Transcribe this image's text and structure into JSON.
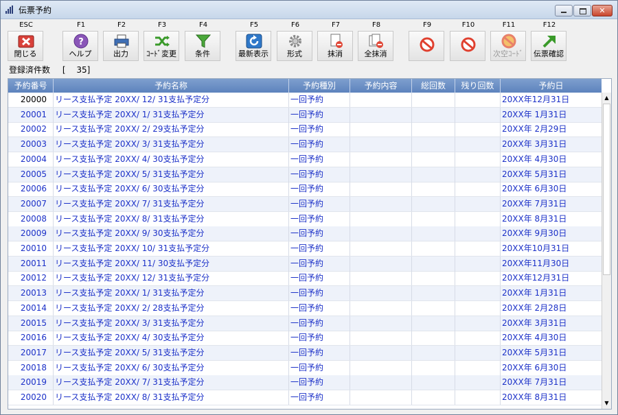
{
  "window": {
    "title": "伝票予約"
  },
  "toolbar": {
    "buttons": [
      {
        "key": "ESC",
        "label": "閉じる",
        "icon": "close-icon"
      },
      {
        "key": "F1",
        "label": "ヘルプ",
        "icon": "help-icon"
      },
      {
        "key": "F2",
        "label": "出力",
        "icon": "printer-icon"
      },
      {
        "key": "F3",
        "label": "ｺｰﾄﾞ変更",
        "icon": "shuffle-icon"
      },
      {
        "key": "F4",
        "label": "条件",
        "icon": "filter-icon"
      },
      {
        "key": "F5",
        "label": "最新表示",
        "icon": "refresh-icon"
      },
      {
        "key": "F6",
        "label": "形式",
        "icon": "gear-icon"
      },
      {
        "key": "F7",
        "label": "抹消",
        "icon": "delete-document-icon"
      },
      {
        "key": "F8",
        "label": "全抹消",
        "icon": "delete-all-icon"
      },
      {
        "key": "F9",
        "label": "",
        "icon": "no-entry-icon"
      },
      {
        "key": "F10",
        "label": "",
        "icon": "no-entry-icon"
      },
      {
        "key": "F11",
        "label": "次空ｺｰﾄﾞ",
        "icon": "no-entry-icon"
      },
      {
        "key": "F12",
        "label": "伝票確認",
        "icon": "arrow-up-right-icon"
      }
    ]
  },
  "status": {
    "registered_label": "登録済件数",
    "registered_value": "[　 35]"
  },
  "table": {
    "columns": [
      "予約番号",
      "予約名称",
      "予約種別",
      "予約内容",
      "総回数",
      "残り回数",
      "予約日"
    ],
    "rows": [
      [
        "20000",
        "リース支払予定 20XX/ 12/ 31支払予定分",
        "一回予約",
        "",
        "",
        "",
        "20XX年12月31日"
      ],
      [
        "20001",
        "リース支払予定 20XX/  1/ 31支払予定分",
        "一回予約",
        "",
        "",
        "",
        "20XX年 1月31日"
      ],
      [
        "20002",
        "リース支払予定 20XX/  2/ 29支払予定分",
        "一回予約",
        "",
        "",
        "",
        "20XX年 2月29日"
      ],
      [
        "20003",
        "リース支払予定 20XX/  3/ 31支払予定分",
        "一回予約",
        "",
        "",
        "",
        "20XX年 3月31日"
      ],
      [
        "20004",
        "リース支払予定 20XX/  4/ 30支払予定分",
        "一回予約",
        "",
        "",
        "",
        "20XX年 4月30日"
      ],
      [
        "20005",
        "リース支払予定 20XX/  5/ 31支払予定分",
        "一回予約",
        "",
        "",
        "",
        "20XX年 5月31日"
      ],
      [
        "20006",
        "リース支払予定 20XX/  6/ 30支払予定分",
        "一回予約",
        "",
        "",
        "",
        "20XX年 6月30日"
      ],
      [
        "20007",
        "リース支払予定 20XX/  7/ 31支払予定分",
        "一回予約",
        "",
        "",
        "",
        "20XX年 7月31日"
      ],
      [
        "20008",
        "リース支払予定 20XX/  8/ 31支払予定分",
        "一回予約",
        "",
        "",
        "",
        "20XX年 8月31日"
      ],
      [
        "20009",
        "リース支払予定 20XX/  9/ 30支払予定分",
        "一回予約",
        "",
        "",
        "",
        "20XX年 9月30日"
      ],
      [
        "20010",
        "リース支払予定 20XX/ 10/ 31支払予定分",
        "一回予約",
        "",
        "",
        "",
        "20XX年10月31日"
      ],
      [
        "20011",
        "リース支払予定 20XX/ 11/ 30支払予定分",
        "一回予約",
        "",
        "",
        "",
        "20XX年11月30日"
      ],
      [
        "20012",
        "リース支払予定 20XX/ 12/ 31支払予定分",
        "一回予約",
        "",
        "",
        "",
        "20XX年12月31日"
      ],
      [
        "20013",
        "リース支払予定 20XX/  1/ 31支払予定分",
        "一回予約",
        "",
        "",
        "",
        "20XX年 1月31日"
      ],
      [
        "20014",
        "リース支払予定 20XX/  2/ 28支払予定分",
        "一回予約",
        "",
        "",
        "",
        "20XX年 2月28日"
      ],
      [
        "20015",
        "リース支払予定 20XX/  3/ 31支払予定分",
        "一回予約",
        "",
        "",
        "",
        "20XX年 3月31日"
      ],
      [
        "20016",
        "リース支払予定 20XX/  4/ 30支払予定分",
        "一回予約",
        "",
        "",
        "",
        "20XX年 4月30日"
      ],
      [
        "20017",
        "リース支払予定 20XX/  5/ 31支払予定分",
        "一回予約",
        "",
        "",
        "",
        "20XX年 5月31日"
      ],
      [
        "20018",
        "リース支払予定 20XX/  6/ 30支払予定分",
        "一回予約",
        "",
        "",
        "",
        "20XX年 6月30日"
      ],
      [
        "20019",
        "リース支払予定 20XX/  7/ 31支払予定分",
        "一回予約",
        "",
        "",
        "",
        "20XX年 7月31日"
      ],
      [
        "20020",
        "リース支払予定 20XX/  8/ 31支払予定分",
        "一回予約",
        "",
        "",
        "",
        "20XX年 8月31日"
      ]
    ]
  },
  "colors": {
    "header": "#6b8fc6",
    "text": "#1b30c8",
    "alt_row": "#eef2fa"
  }
}
